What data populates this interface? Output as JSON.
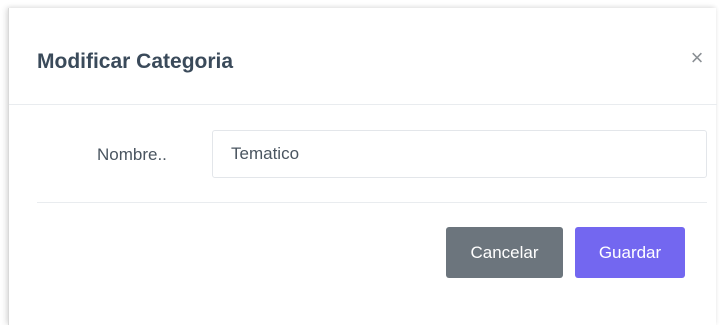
{
  "modal": {
    "title": "Modificar Categoria",
    "close_label": "×"
  },
  "form": {
    "name_label": "Nombre..",
    "name_value": "Tematico"
  },
  "footer": {
    "cancel_label": "Cancelar",
    "save_label": "Guardar"
  },
  "colors": {
    "cancel_button": "#6c757d",
    "save_button": "#7367f0",
    "title_text": "#3a4a5a"
  }
}
